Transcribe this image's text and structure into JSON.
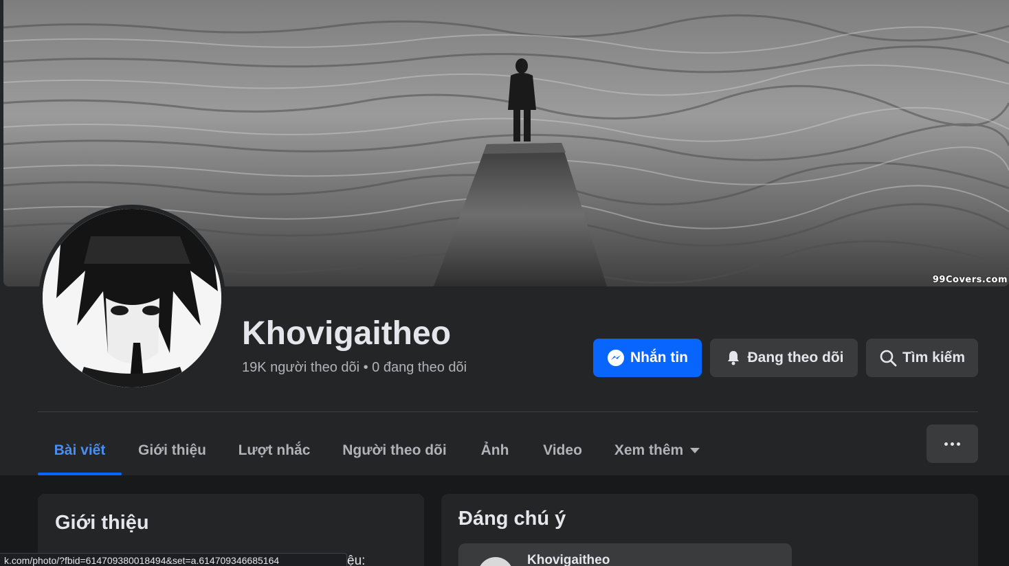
{
  "cover": {
    "watermark": "99Covers.com"
  },
  "profile": {
    "name": "Khovigaitheo",
    "stats": "19K người theo dõi • 0 đang theo dõi"
  },
  "actions": {
    "message_label": "Nhắn tin",
    "following_label": "Đang theo dõi",
    "search_label": "Tìm kiếm"
  },
  "tabs": [
    {
      "label": "Bài viết",
      "active": true
    },
    {
      "label": "Giới thiệu",
      "active": false
    },
    {
      "label": "Lượt nhắc",
      "active": false
    },
    {
      "label": "Người theo dõi",
      "active": false
    },
    {
      "label": "Ảnh",
      "active": false
    },
    {
      "label": "Video",
      "active": false
    },
    {
      "label": "Xem thêm",
      "active": false
    }
  ],
  "intro": {
    "title": "Giới thiệu",
    "partial_text": "ệu:"
  },
  "featured": {
    "title": "Đáng chú ý",
    "post_author": "Khovigaitheo"
  },
  "status_bar": {
    "url": "k.com/photo/?fbid=614709380018494&set=a.614709346685164"
  },
  "colors": {
    "accent": "#0866ff",
    "active_tab": "#4a8ff0",
    "surface": "#242526",
    "background": "#18191a",
    "button": "#3a3b3c"
  },
  "icons": [
    "messenger-icon",
    "bell-icon",
    "search-icon",
    "caret-down-icon",
    "ellipsis-icon"
  ]
}
